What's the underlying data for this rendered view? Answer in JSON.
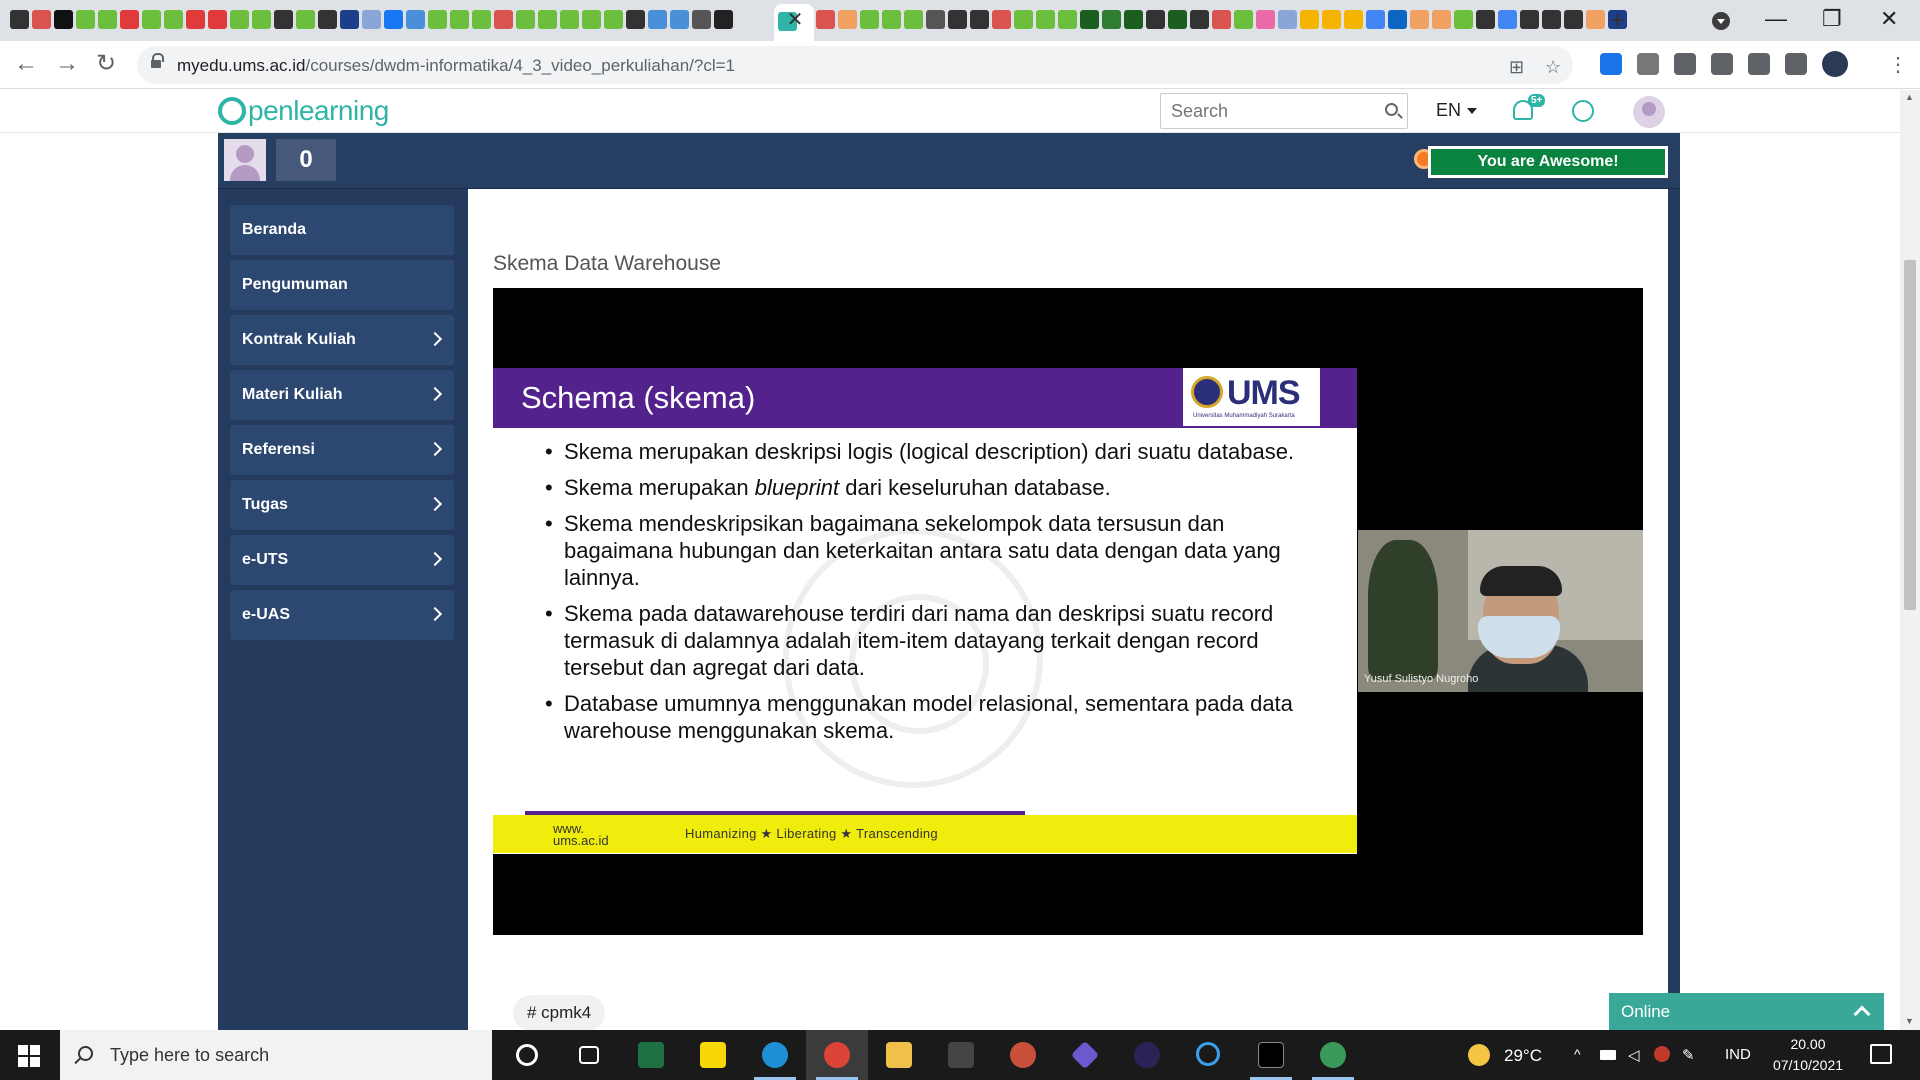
{
  "browser": {
    "url_host": "myedu.ums.ac.id",
    "url_path": "/courses/dwdm-informatika/4_3_video_perkuliahan/?cl=1",
    "tab_close": "✕",
    "new_tab": "+",
    "window_controls": {
      "minimize": "—",
      "maximize": "❐",
      "close": "✕"
    },
    "nav": {
      "back": "←",
      "forward": "→",
      "reload": "↻"
    },
    "menu": "⋮"
  },
  "site": {
    "logo_text": "penlearning",
    "search_placeholder": "Search",
    "language": "EN",
    "notification_badge": "5+",
    "colors": {
      "brand": "#2fb5a7",
      "frame": "#243b5e",
      "awesome": "#09843f"
    }
  },
  "course_bar": {
    "points": "0",
    "badge_text": "You are Awesome!"
  },
  "sidebar": {
    "items": [
      {
        "label": "Beranda",
        "has_chevron": false
      },
      {
        "label": "Pengumuman",
        "has_chevron": false
      },
      {
        "label": "Kontrak Kuliah",
        "has_chevron": true
      },
      {
        "label": "Materi Kuliah",
        "has_chevron": true
      },
      {
        "label": "Referensi",
        "has_chevron": true
      },
      {
        "label": "Tugas",
        "has_chevron": true
      },
      {
        "label": "e-UTS",
        "has_chevron": true
      },
      {
        "label": "e-UAS",
        "has_chevron": true
      }
    ]
  },
  "lesson": {
    "title": "Skema Data Warehouse",
    "tag": "# cpmk4"
  },
  "slide": {
    "title": "Schema (skema)",
    "logo": "UMS",
    "logo_sub": "Universitas Muhammadiyah Surakarta",
    "bullets": [
      "Skema merupakan deskripsi logis (logical description) dari suatu database.",
      "Skema merupakan blueprint dari keseluruhan database.",
      "Skema mendeskripsikan bagaimana sekelompok data tersusun dan bagaimana hubungan dan keterkaitan antara satu data dengan data yang lainnya.",
      "Skema pada datawarehouse terdiri dari nama dan deskripsi suatu record termasuk di dalamnya adalah item-item datayang terkait dengan record tersebut dan agregat dari data.",
      "Database umumnya menggunakan model relasional, sementara pada data warehouse menggunakan skema."
    ],
    "footer_web_1": "www.",
    "footer_web_2": "ums.ac.id",
    "footer_tagline": "Humanizing ★ Liberating ★ Transcending"
  },
  "webcam": {
    "name": "Yusuf Sulistyo Nugroho"
  },
  "online_widget": {
    "label": "Online"
  },
  "taskbar": {
    "search_placeholder": "Type here to search",
    "temperature": "29°C",
    "language": "IND",
    "time": "20.00",
    "date": "07/10/2021"
  }
}
